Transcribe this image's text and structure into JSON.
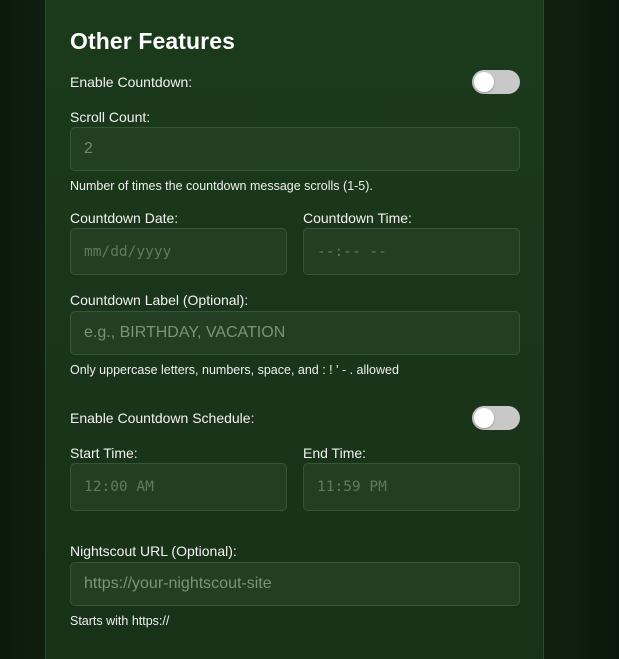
{
  "section": {
    "title": "Other Features"
  },
  "countdown": {
    "enable_label": "Enable Countdown:",
    "enabled": false,
    "scroll_count_label": "Scroll Count:",
    "scroll_count_value": "2",
    "scroll_count_hint": "Number of times the countdown message scrolls (1-5).",
    "date_label": "Countdown Date:",
    "date_placeholder": "mm/dd/yyyy",
    "time_label": "Countdown Time:",
    "time_placeholder": "--:-- --",
    "label_label": "Countdown Label (Optional):",
    "label_placeholder": "e.g., BIRTHDAY, VACATION",
    "label_hint": "Only uppercase letters, numbers, space, and : ! ' - . allowed"
  },
  "schedule": {
    "enable_label": "Enable Countdown Schedule:",
    "enabled": false,
    "start_label": "Start Time:",
    "start_value": "12:00 AM",
    "end_label": "End Time:",
    "end_value": "11:59 PM"
  },
  "nightscout": {
    "url_label": "Nightscout URL (Optional):",
    "url_placeholder": "https://your-nightscout-site",
    "url_hint": "Starts with https://"
  },
  "colors": {
    "page_background": "#132613",
    "panel_background": "#1b3a1b",
    "input_background": "#233f23",
    "toggle_off": "#c8c8c8"
  }
}
